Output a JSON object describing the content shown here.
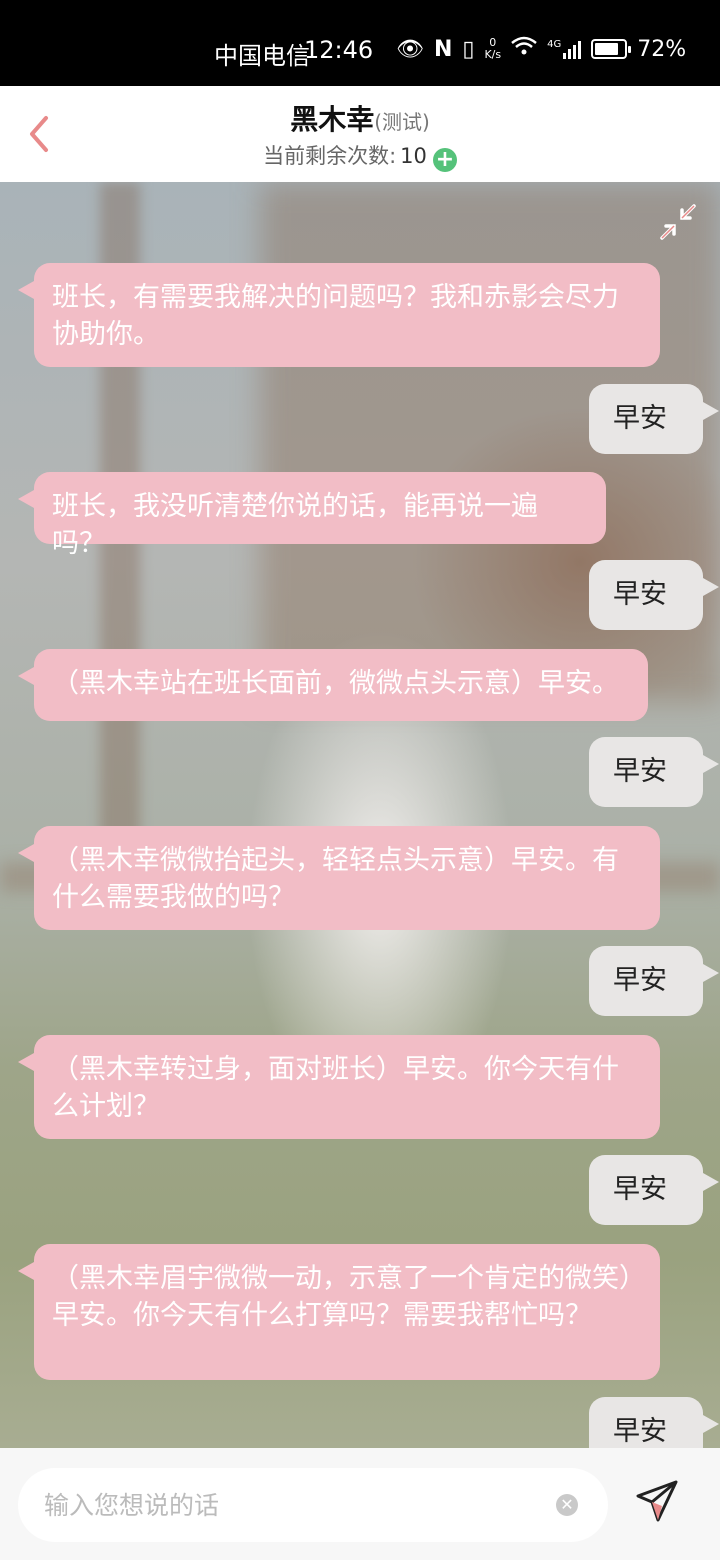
{
  "status_bar": {
    "carrier": "中国电信",
    "time": "12:46",
    "net_speed_value": "0",
    "net_speed_unit": "K/s",
    "network": "4G",
    "battery": "72%"
  },
  "header": {
    "title": "黑木幸",
    "title_tag": "(测试)",
    "remaining_label": "当前剩余次数:",
    "remaining_count": "10"
  },
  "messages": [
    {
      "side": "left",
      "text": "班长，有需要我解决的问题吗？我和赤影会尽力协助你。"
    },
    {
      "side": "right",
      "text": "早安"
    },
    {
      "side": "left",
      "text": "班长，我没听清楚你说的话，能再说一遍吗？"
    },
    {
      "side": "right",
      "text": "早安"
    },
    {
      "side": "left",
      "text": "（黑木幸站在班长面前，微微点头示意）早安。"
    },
    {
      "side": "right",
      "text": "早安"
    },
    {
      "side": "left",
      "text": "（黑木幸微微抬起头，轻轻点头示意）早安。有什么需要我做的吗？"
    },
    {
      "side": "right",
      "text": "早安"
    },
    {
      "side": "left",
      "text": "（黑木幸转过身，面对班长）早安。你今天有什么计划？"
    },
    {
      "side": "right",
      "text": "早安"
    },
    {
      "side": "left",
      "text": "（黑木幸眉宇微微一动，示意了一个肯定的微笑）早安。你今天有什么打算吗？需要我帮忙吗？"
    },
    {
      "side": "right",
      "text": "早安"
    }
  ],
  "input": {
    "placeholder": "输入您想说的话"
  },
  "colors": {
    "bubble_ai": "#f2bdc6",
    "bubble_user": "#e8e6e5",
    "back_arrow": "#e88a8a",
    "plus_badge": "#55c27a"
  }
}
